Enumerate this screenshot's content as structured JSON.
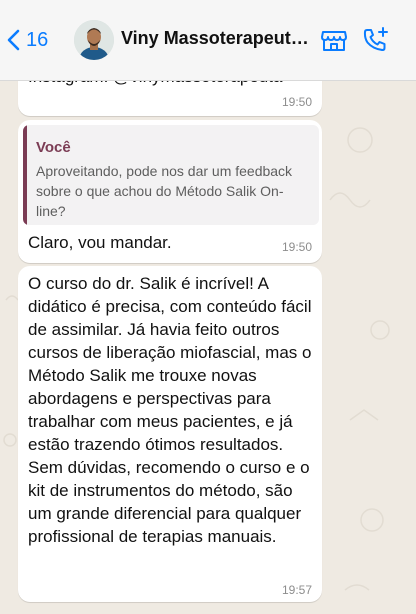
{
  "header": {
    "back_count": "16",
    "contact_name": "Viny Massoterapeuta..."
  },
  "messages": [
    {
      "text": "Instagram: @vinymassoterapeuta",
      "time": "19:50"
    },
    {
      "quote_author": "Você",
      "quote_text": "Aproveitando, pode nos dar um feedback sobre o que achou do Método Salik On-line?",
      "text": "Claro, vou mandar.",
      "time": "19:50"
    },
    {
      "text": "O curso do dr. Salik é incrível! A didático é precisa, com conteúdo fácil de assimilar. Já havia feito outros cursos de liberação miofascial, mas o Método Salik me trouxe novas abordagens e perspectivas para trabalhar com meus pacientes, e já estão trazendo ótimos resultados.\nSem dúvidas, recomendo o curso e o kit de instrumentos do método, são um grande diferencial para qualquer profissional de terapias manuais.",
      "time": "19:57"
    }
  ],
  "icons": {
    "back": "chevron-left-icon",
    "store": "storefront-icon",
    "call": "add-call-icon"
  },
  "colors": {
    "accent": "#0a7cff",
    "quote_author": "#7b3c54",
    "chat_background": "#efeae2"
  }
}
